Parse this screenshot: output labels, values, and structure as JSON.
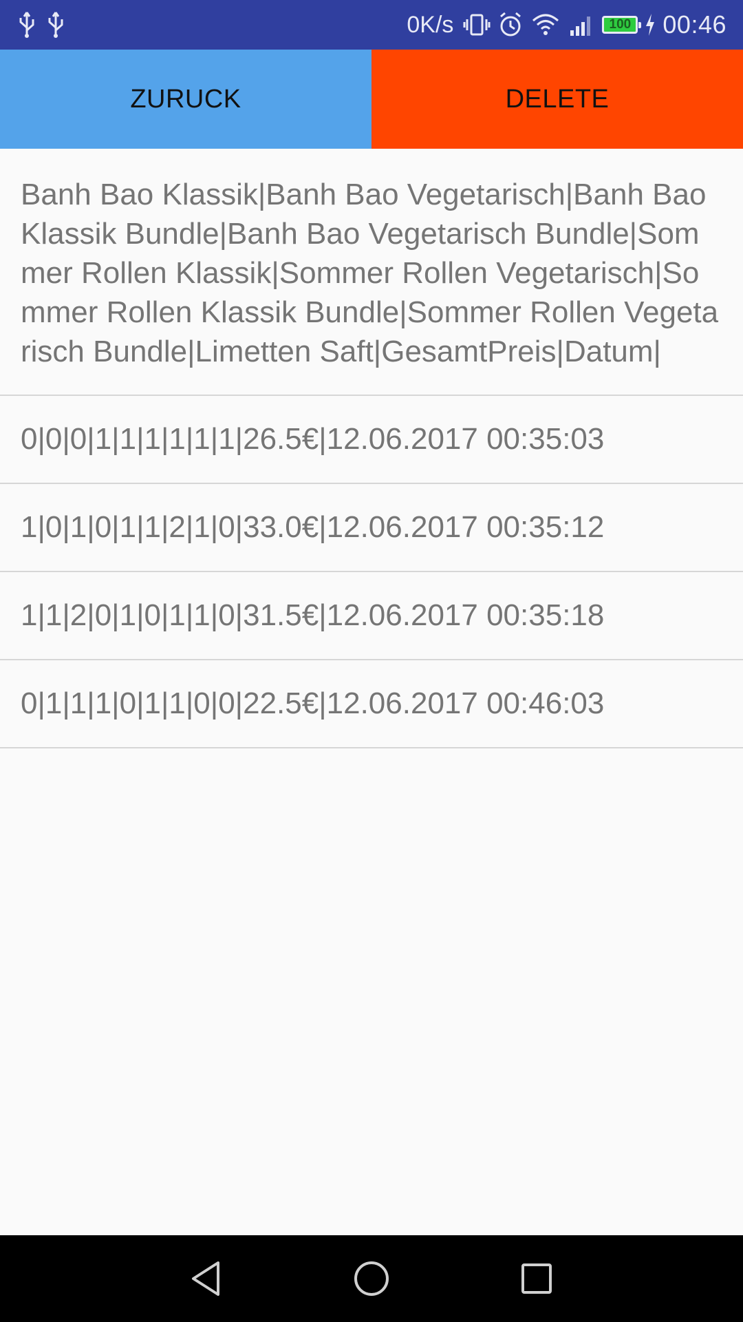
{
  "status_bar": {
    "net_speed": "0K/s",
    "battery_level": "100",
    "time": "00:46",
    "icons": [
      "usb-icon",
      "usb-icon",
      "vibrate-icon",
      "alarm-icon",
      "wifi-icon",
      "signal-icon",
      "battery-icon",
      "charging-icon"
    ]
  },
  "toolbar": {
    "back_label": "ZURUCK",
    "delete_label": "DELETE",
    "back_color": "#54a3ea",
    "delete_color": "#ff4500"
  },
  "list": {
    "header": "Banh Bao Klassik|Banh Bao Vegetarisch|Banh Bao Klassik Bundle|Banh Bao Vegetarisch Bundle|Sommer Rollen Klassik|Sommer Rollen Vegetarisch|Sommer Rollen Klassik Bundle|Sommer Rollen Vegetarisch Bundle|Limetten Saft|GesamtPreis|Datum|",
    "rows": [
      "0|0|0|1|1|1|1|1|1|26.5€|12.06.2017 00:35:03",
      "1|0|1|0|1|1|2|1|0|33.0€|12.06.2017 00:35:12",
      "1|1|2|0|1|0|1|1|0|31.5€|12.06.2017 00:35:18",
      "0|1|1|1|0|1|1|0|0|22.5€|12.06.2017 00:46:03"
    ]
  },
  "nav_bar": {
    "icons": [
      "back-icon",
      "home-icon",
      "recents-icon"
    ]
  }
}
